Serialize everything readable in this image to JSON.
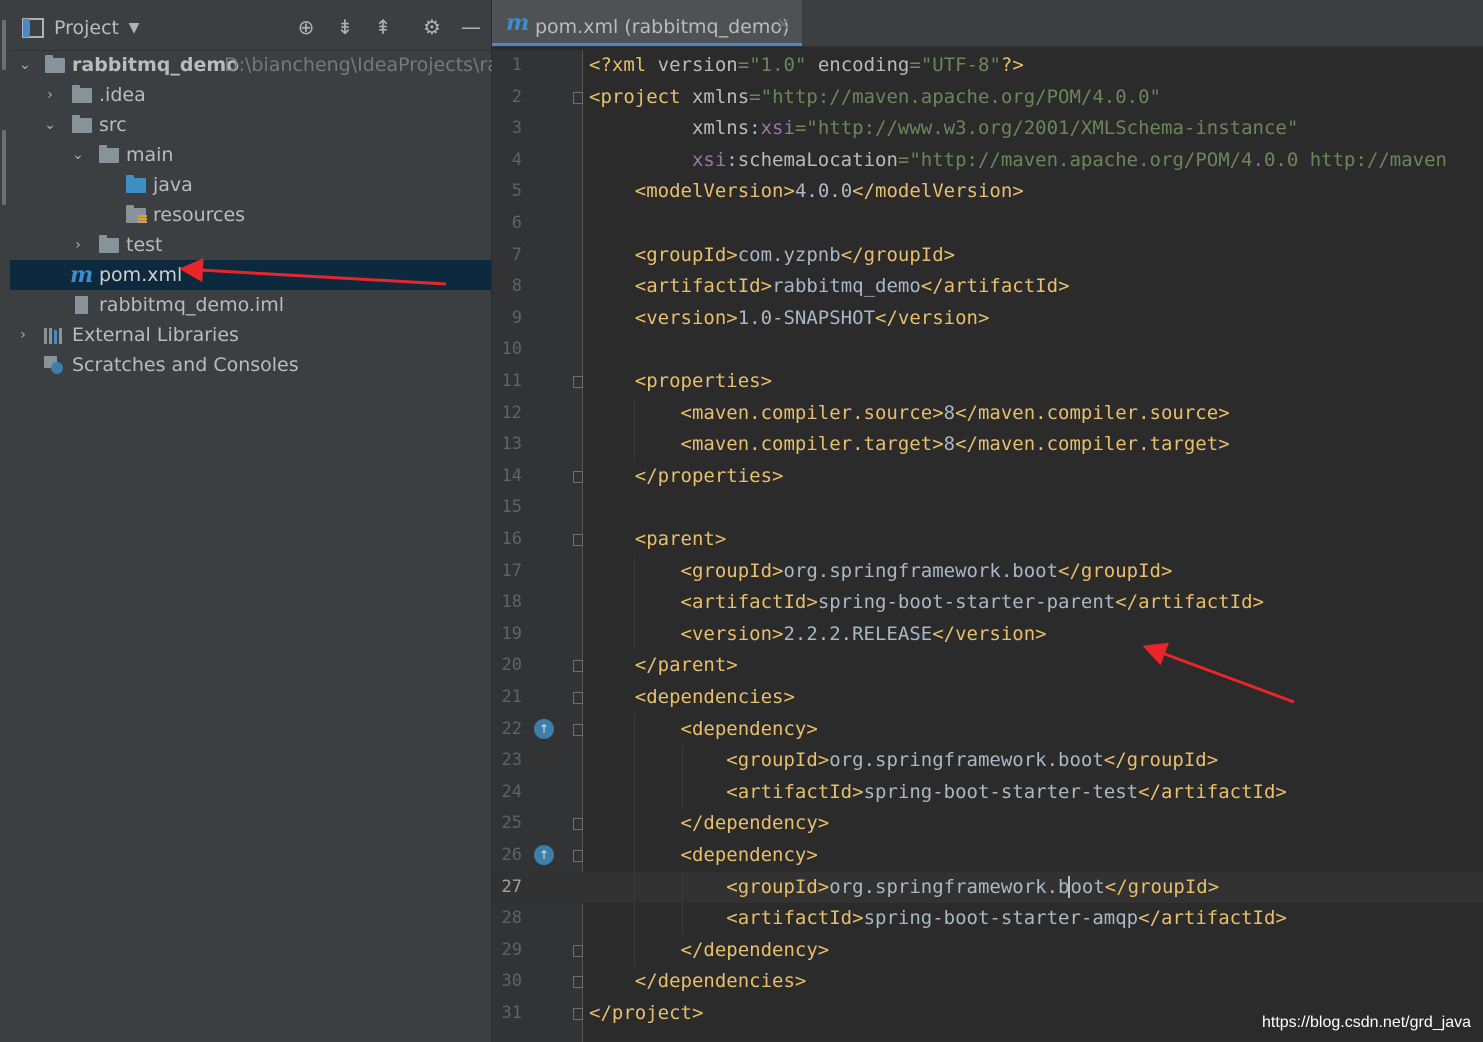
{
  "project_panel": {
    "title": "Project",
    "header_icons": [
      "locate-icon",
      "expand-all-icon",
      "collapse-all-icon",
      "gear-icon",
      "minimize-icon"
    ],
    "tree": [
      {
        "label": "rabbitmq_demo",
        "path": "D:\\biancheng\\IdeaProjects\\rab",
        "icon": "module-folder-icon"
      },
      {
        "label": ".idea",
        "icon": "folder-icon"
      },
      {
        "label": "src",
        "icon": "folder-icon"
      },
      {
        "label": "main",
        "icon": "folder-icon"
      },
      {
        "label": "java",
        "icon": "source-folder-icon"
      },
      {
        "label": "resources",
        "icon": "resources-folder-icon"
      },
      {
        "label": "test",
        "icon": "folder-icon"
      },
      {
        "label": "pom.xml",
        "icon": "maven-icon",
        "selected": true
      },
      {
        "label": "rabbitmq_demo.iml",
        "icon": "iml-file-icon"
      },
      {
        "label": "External Libraries",
        "icon": "libraries-icon"
      },
      {
        "label": "Scratches and Consoles",
        "icon": "scratches-icon"
      }
    ]
  },
  "editor": {
    "tab_label": "pom.xml (rabbitmq_demo)",
    "tab_icon": "maven-icon",
    "current_line": 27,
    "line_numbers": [
      "1",
      "2",
      "3",
      "4",
      "5",
      "6",
      "7",
      "8",
      "9",
      "10",
      "11",
      "12",
      "13",
      "14",
      "15",
      "16",
      "17",
      "18",
      "19",
      "20",
      "21",
      "22",
      "23",
      "24",
      "25",
      "26",
      "27",
      "28",
      "29",
      "30",
      "31"
    ],
    "lines": [
      "<?xml version=\"1.0\" encoding=\"UTF-8\"?>",
      "<project xmlns=\"http://maven.apache.org/POM/4.0.0\"",
      "         xmlns:xsi=\"http://www.w3.org/2001/XMLSchema-instance\"",
      "         xsi:schemaLocation=\"http://maven.apache.org/POM/4.0.0 http://maven",
      "    <modelVersion>4.0.0</modelVersion>",
      "",
      "    <groupId>com.yzpnb</groupId>",
      "    <artifactId>rabbitmq_demo</artifactId>",
      "    <version>1.0-SNAPSHOT</version>",
      "",
      "    <properties>",
      "        <maven.compiler.source>8</maven.compiler.source>",
      "        <maven.compiler.target>8</maven.compiler.target>",
      "    </properties>",
      "",
      "    <parent>",
      "        <groupId>org.springframework.boot</groupId>",
      "        <artifactId>spring-boot-starter-parent</artifactId>",
      "        <version>2.2.2.RELEASE</version>",
      "    </parent>",
      "    <dependencies>",
      "        <dependency>",
      "            <groupId>org.springframework.boot</groupId>",
      "            <artifactId>spring-boot-starter-test</artifactId>",
      "        </dependency>",
      "        <dependency>",
      "            <groupId>org.springframework.boot</groupId>",
      "            <artifactId>spring-boot-starter-amqp</artifactId>",
      "        </dependency>",
      "    </dependencies>",
      "</project>"
    ]
  },
  "watermark": "https://blog.csdn.net/grd_java",
  "colors": {
    "tag": "#e8bf6a",
    "string": "#6a8759",
    "text": "#a9b7c6",
    "namespace": "#9876aa",
    "annotation_arrow": "#e8262a"
  }
}
